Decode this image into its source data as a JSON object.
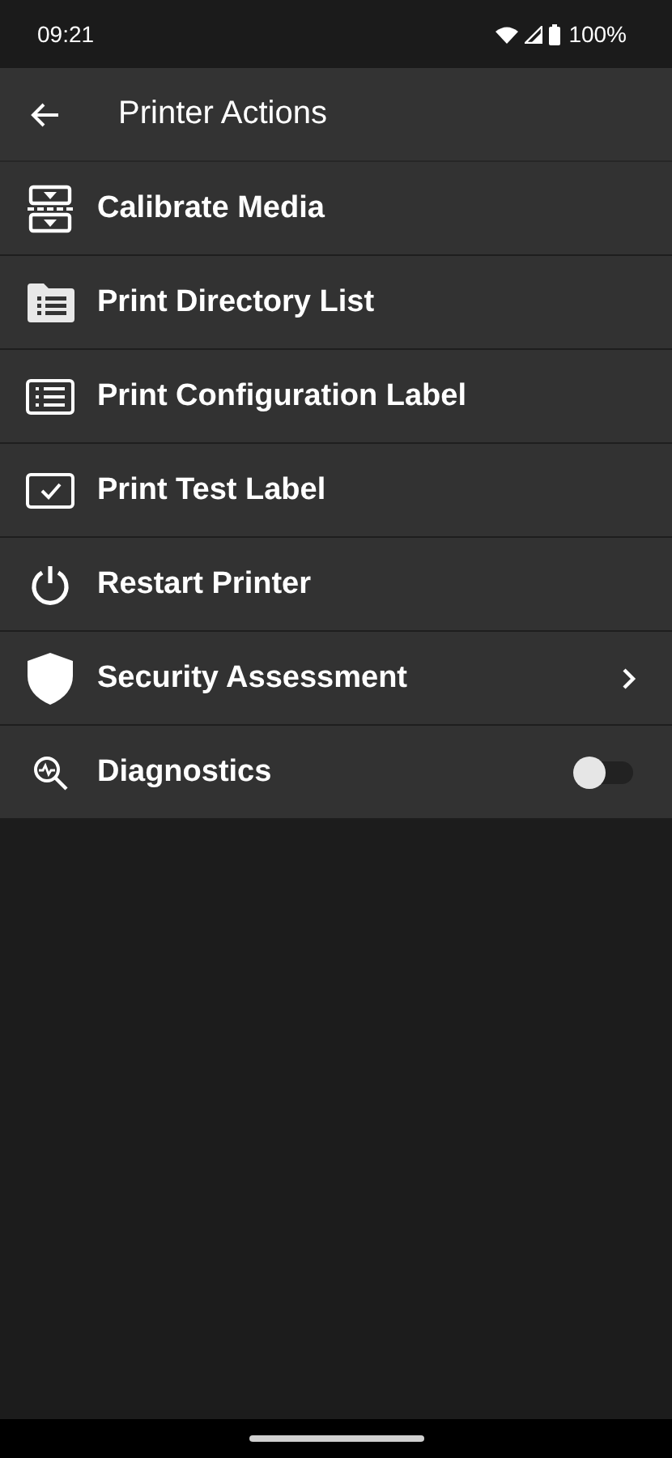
{
  "status_bar": {
    "time": "09:21",
    "battery": "100%"
  },
  "app_bar": {
    "title": "Printer Actions"
  },
  "items": [
    {
      "label": "Calibrate Media",
      "kind": "action"
    },
    {
      "label": "Print Directory List",
      "kind": "action"
    },
    {
      "label": "Print Configuration Label",
      "kind": "action"
    },
    {
      "label": "Print Test Label",
      "kind": "action"
    },
    {
      "label": "Restart Printer",
      "kind": "action"
    },
    {
      "label": "Security Assessment",
      "kind": "link"
    },
    {
      "label": "Diagnostics",
      "kind": "toggle",
      "on": false
    }
  ]
}
